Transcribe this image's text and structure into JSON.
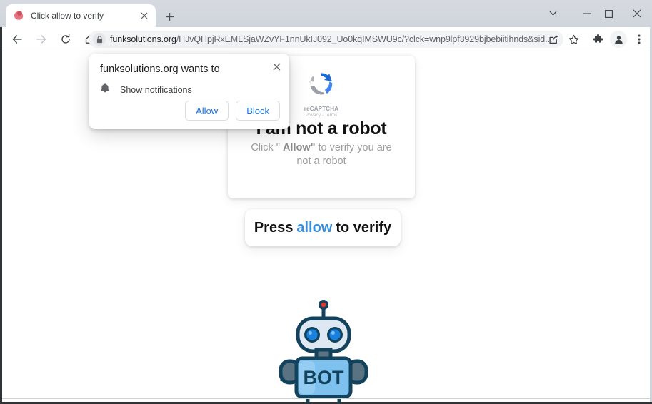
{
  "window": {
    "controls": {
      "tab_search": "tab-search-chevron",
      "minimize": "minimize",
      "maximize": "maximize",
      "close": "close"
    }
  },
  "tabstrip": {
    "tabs": [
      {
        "title": "Click allow to verify",
        "favicon": "site-favicon",
        "close_label": "close-tab"
      }
    ],
    "new_tab_label": "+"
  },
  "toolbar": {
    "back_icon": "back-arrow-icon",
    "forward_icon": "forward-arrow-icon",
    "reload_icon": "reload-icon",
    "home_icon": "home-icon",
    "lock_icon": "lock-icon",
    "url_host": "funksolutions.org",
    "url_path": "/HJvQHpjRxEMLSjaWZvYF1nnUkIJ092_Uo0kqIMSWU9c/?clck=wnp9lpf3929bjbebiitihnds&sid...",
    "url_full": "funksolutions.org/HJvQHpjRxEMLSjaWZvYF1nnUkIJ092_Uo0kqIMSWU9c/?clck=wnp9lpf3929bjbebiitihnds&sid...",
    "share_icon": "share-icon",
    "bookmark_icon": "bookmark-star-icon",
    "extensions_icon": "extensions-puzzle-icon",
    "profile_icon": "profile-avatar-icon",
    "menu_icon": "three-dot-menu-icon"
  },
  "permission_dialog": {
    "title": "funksolutions.org wants to",
    "permission_icon": "bell-icon",
    "permission_label": "Show notifications",
    "allow_label": "Allow",
    "block_label": "Block",
    "close_icon": "close-icon",
    "accent_color": "#1a73e8"
  },
  "page": {
    "recaptcha": {
      "logo_icon": "recaptcha-logo-icon",
      "wordmark": "reCAPTCHA",
      "legal": "Privacy - Terms"
    },
    "headline": "I am not a robot",
    "subline_pre": "Click \" ",
    "subline_bold": "Allow\"",
    "subline_post": " to verify you are not a robot",
    "press_button": {
      "pre": "Press",
      "highlight": "allow",
      "post": "to verify",
      "highlight_color": "#3b8ede"
    },
    "robot": {
      "body_text": "BOT",
      "outline_color": "#12425c",
      "body_color": "#7ec1ef",
      "eye_color": "#1b7fe0",
      "antenna_color": "#e0392b",
      "arm_color": "#5a7383"
    },
    "background_color": "#ffffff"
  }
}
